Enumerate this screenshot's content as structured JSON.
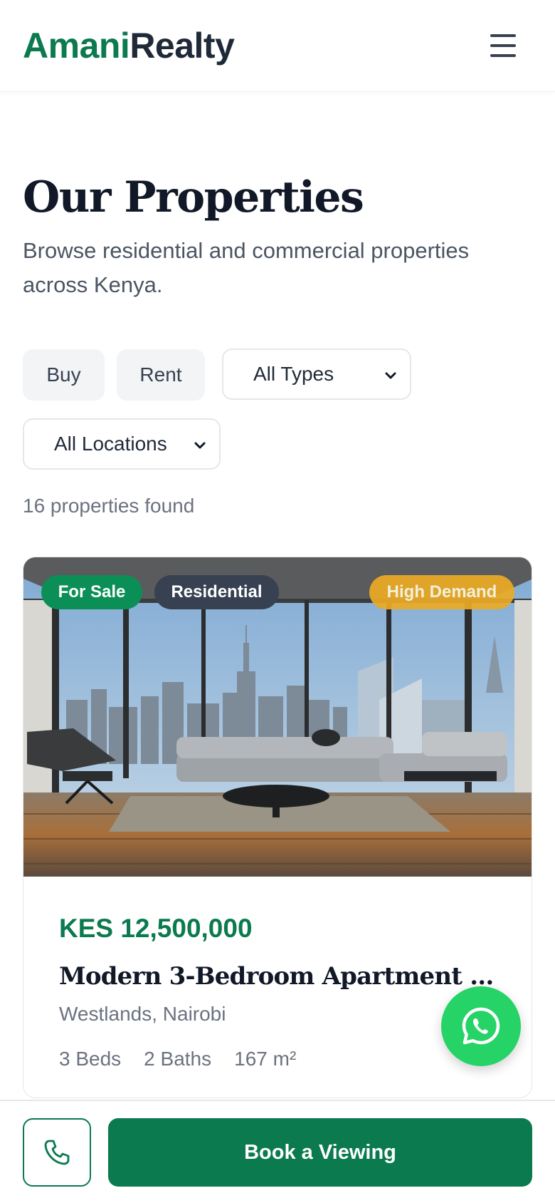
{
  "header": {
    "logo_part1": "Amani",
    "logo_part2": "Realty",
    "menu_icon": "hamburger-menu-icon"
  },
  "page": {
    "title": "Our Properties",
    "subtitle": "Browse residential and commercial properties across Kenya."
  },
  "filters": {
    "buy_label": "Buy",
    "rent_label": "Rent",
    "type_select": "All Types",
    "location_select": "All Locations"
  },
  "results": {
    "count_text": "16 properties found"
  },
  "listing": {
    "badges": {
      "status": "For Sale",
      "category": "Residential",
      "demand": "High Demand"
    },
    "price": "KES 12,500,000",
    "title": "Modern 3-Bedroom Apartment in...",
    "location": "Westlands, Nairobi",
    "beds": "3 Beds",
    "baths": "2 Baths",
    "area": "167 m²",
    "image": "modern-apartment-living-room-city-view"
  },
  "actions": {
    "whatsapp_icon": "whatsapp-icon",
    "call_icon": "phone-icon",
    "book_label": "Book a Viewing"
  },
  "colors": {
    "brand_green": "#0b7a4f",
    "whatsapp_green": "#25d366",
    "demand_badge": "#eaaa24",
    "category_badge": "#374151"
  }
}
